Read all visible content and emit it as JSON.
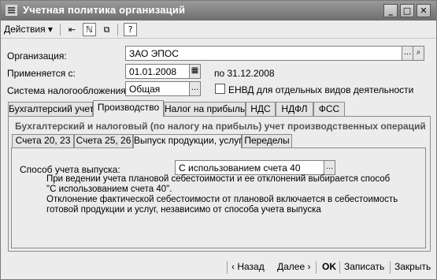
{
  "window": {
    "title": "Учетная политика организаций"
  },
  "menubar": {
    "actions_label": "Действия",
    "actions_arrow": "▾",
    "help_label": "?"
  },
  "form": {
    "organization_label": "Организация:",
    "organization_value": "ЗАО ЭПОС",
    "applies_label": "Применяется с:",
    "applies_value": "01.01.2008",
    "applies_to": "по 31.12.2008",
    "tax_system_label": "Система налогообложения:",
    "tax_system_value": "Общая",
    "envd_label": "ЕНВД для отдельных видов деятельности",
    "envd_checked": false,
    "ellipsis": "...",
    "search_glyph": "⌕"
  },
  "tabs": [
    {
      "label": "Бухгалтерский учет",
      "active": false
    },
    {
      "label": "Производство",
      "active": true
    },
    {
      "label": "Налог на прибыль",
      "active": false
    },
    {
      "label": "НДС",
      "active": false
    },
    {
      "label": "НДФЛ",
      "active": false
    },
    {
      "label": "ФСС",
      "active": false
    }
  ],
  "production": {
    "section_title": "Бухгалтерский и налоговый (по налогу на прибыль) учет производственных операций",
    "subtabs": [
      {
        "label": "Счета 20, 23",
        "active": false
      },
      {
        "label": "Счета 25, 26",
        "active": false
      },
      {
        "label": "Выпуск продукции, услуг",
        "active": true
      },
      {
        "label": "Переделы",
        "active": false
      }
    ],
    "method_label": "Способ учета выпуска:",
    "method_value": "С использованием счета 40",
    "note": "При ведении учета плановой себестоимости и ее отклонений выбирается способ\n\"С использованием счета 40\".\nОтклонение фактической себестоимости от плановой включается в себестоимость\nготовой продукции и услуг, независимо от способа учета выпуска"
  },
  "bottom": {
    "back_label": "‹ Назад",
    "next_label": "Далее ›",
    "ok_label": "OK",
    "save_label": "Записать",
    "close_label": "Закрыть"
  }
}
